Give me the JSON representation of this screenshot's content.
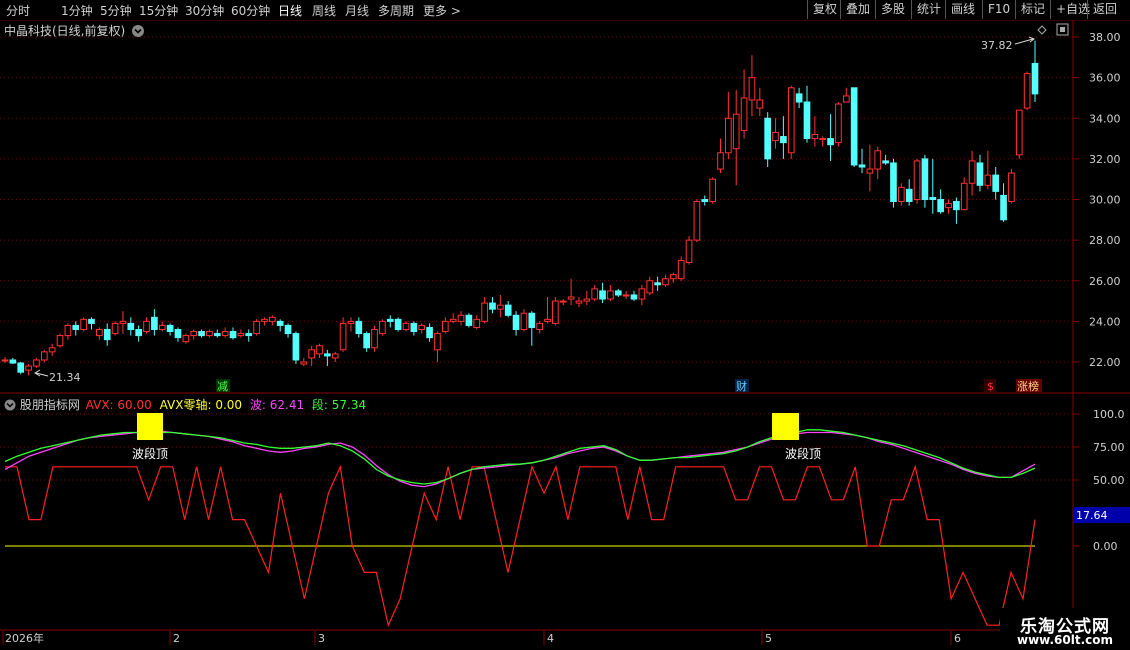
{
  "toolbar": {
    "timeframes": [
      "分时",
      "1分钟",
      "5分钟",
      "15分钟",
      "30分钟",
      "60分钟",
      "日线",
      "周线",
      "月线",
      "多周期",
      "更多"
    ],
    "active": "日线",
    "more_arrow": ">",
    "right_buttons": [
      "复权",
      "叠加",
      "多股",
      "统计",
      "画线",
      "F10",
      "标记",
      "+自选",
      "返回"
    ]
  },
  "stock": {
    "title": "中晶科技(日线,前复权)",
    "high_label": "37.82",
    "low_label": "21.34"
  },
  "price_axis": [
    "38.00",
    "36.00",
    "34.00",
    "32.00",
    "30.00",
    "28.00",
    "26.00",
    "24.00",
    "22.00"
  ],
  "markers": {
    "jian": "减",
    "cai": "财",
    "dollar": "$",
    "zhangting": "涨榜"
  },
  "indicator": {
    "name": "股朋指标网",
    "avx_label": "AVX: 60.00",
    "axis_label": "AVX零轴: 0.00",
    "bo_label": "波: 62.41",
    "duan_label": "段: 57.34",
    "current_value": "17.64",
    "axis": [
      "100.0",
      "75.00",
      "50.00",
      "0.00"
    ],
    "annotations": [
      "波段顶",
      "波段顶"
    ]
  },
  "date_axis": [
    "2026年",
    "2",
    "3",
    "4",
    "5",
    "6"
  ],
  "watermark": {
    "line1": "乐淘公式网",
    "line2": "www.60lt.com"
  },
  "colors": {
    "up": "#ff3232",
    "down": "#54ffff",
    "bo": "#ff44ff",
    "duan": "#33ff33",
    "avx": "#ff2222",
    "zero": "#ffff00",
    "marker": "#ffff00"
  },
  "chart_data": {
    "type": "candlestick",
    "price_ylim": [
      21,
      38.5
    ],
    "indicator_ylim": [
      -12,
      108
    ],
    "candles": [
      [
        22.05,
        22.1,
        21.95,
        22.25
      ],
      [
        22.1,
        21.95,
        21.9,
        22.2
      ],
      [
        21.95,
        21.5,
        21.4,
        22.0
      ],
      [
        21.6,
        21.8,
        21.34,
        21.9
      ],
      [
        21.8,
        22.1,
        21.7,
        22.2
      ],
      [
        22.1,
        22.5,
        22.0,
        22.6
      ],
      [
        22.5,
        22.7,
        22.3,
        22.9
      ],
      [
        22.8,
        23.3,
        22.7,
        23.4
      ],
      [
        23.3,
        23.8,
        23.1,
        23.9
      ],
      [
        23.8,
        23.6,
        23.3,
        24.0
      ],
      [
        23.6,
        24.1,
        23.5,
        24.2
      ],
      [
        24.1,
        23.9,
        23.6,
        24.2
      ],
      [
        23.3,
        23.6,
        23.1,
        23.7
      ],
      [
        23.6,
        23.1,
        22.8,
        23.9
      ],
      [
        23.4,
        23.9,
        23.3,
        24.0
      ],
      [
        23.9,
        24.0,
        23.4,
        24.5
      ],
      [
        23.9,
        23.6,
        23.3,
        24.2
      ],
      [
        23.6,
        23.3,
        23.0,
        23.8
      ],
      [
        23.5,
        24.0,
        23.4,
        24.2
      ],
      [
        24.2,
        23.6,
        23.3,
        24.6
      ],
      [
        23.6,
        23.8,
        23.5,
        24.0
      ],
      [
        23.8,
        23.5,
        23.3,
        23.9
      ],
      [
        23.6,
        23.2,
        23.0,
        23.7
      ],
      [
        23.0,
        23.3,
        22.9,
        23.4
      ],
      [
        23.3,
        23.5,
        23.1,
        23.6
      ],
      [
        23.5,
        23.3,
        23.2,
        23.6
      ],
      [
        23.3,
        23.5,
        23.2,
        23.6
      ],
      [
        23.4,
        23.3,
        23.2,
        23.6
      ],
      [
        23.3,
        23.5,
        23.2,
        23.7
      ],
      [
        23.5,
        23.2,
        23.1,
        23.7
      ],
      [
        23.3,
        23.4,
        23.2,
        23.6
      ],
      [
        23.4,
        23.3,
        23.0,
        23.6
      ],
      [
        23.4,
        24.0,
        23.3,
        24.1
      ],
      [
        24.0,
        24.1,
        23.8,
        24.2
      ],
      [
        24.0,
        24.2,
        23.8,
        24.3
      ],
      [
        24.0,
        23.8,
        23.5,
        24.1
      ],
      [
        23.8,
        23.4,
        23.2,
        23.9
      ],
      [
        23.4,
        22.1,
        21.9,
        23.5
      ],
      [
        21.9,
        22.0,
        21.8,
        22.2
      ],
      [
        22.2,
        22.6,
        21.8,
        22.8
      ],
      [
        22.4,
        22.8,
        22.2,
        22.9
      ],
      [
        22.4,
        22.3,
        21.8,
        22.6
      ],
      [
        22.2,
        22.4,
        22.0,
        22.5
      ],
      [
        22.6,
        23.9,
        22.5,
        24.2
      ],
      [
        23.9,
        24.0,
        23.5,
        24.2
      ],
      [
        24.0,
        23.4,
        23.2,
        24.2
      ],
      [
        23.4,
        22.7,
        22.5,
        23.5
      ],
      [
        22.7,
        23.6,
        22.5,
        23.8
      ],
      [
        23.4,
        24.0,
        23.3,
        24.1
      ],
      [
        24.1,
        24.0,
        23.7,
        24.3
      ],
      [
        24.1,
        23.6,
        23.5,
        24.2
      ],
      [
        23.6,
        23.9,
        23.5,
        24.0
      ],
      [
        23.9,
        23.5,
        23.3,
        24.0
      ],
      [
        23.6,
        23.8,
        23.4,
        23.9
      ],
      [
        23.7,
        23.2,
        23.0,
        23.9
      ],
      [
        22.6,
        23.4,
        22.0,
        23.5
      ],
      [
        23.5,
        24.0,
        23.4,
        24.2
      ],
      [
        24.0,
        24.1,
        23.9,
        24.4
      ],
      [
        24.0,
        24.3,
        23.8,
        24.5
      ],
      [
        24.3,
        23.8,
        23.7,
        24.4
      ],
      [
        23.7,
        24.1,
        23.6,
        24.3
      ],
      [
        24.0,
        24.9,
        23.9,
        25.2
      ],
      [
        24.9,
        24.6,
        24.4,
        25.2
      ],
      [
        24.6,
        24.8,
        24.2,
        25.3
      ],
      [
        24.8,
        24.3,
        24.2,
        25.0
      ],
      [
        24.3,
        23.6,
        23.3,
        24.5
      ],
      [
        23.6,
        24.4,
        23.5,
        24.6
      ],
      [
        24.4,
        23.7,
        22.8,
        24.5
      ],
      [
        23.6,
        23.9,
        23.4,
        24.0
      ],
      [
        24.0,
        24.1,
        23.9,
        25.2
      ],
      [
        23.9,
        25.0,
        23.8,
        25.2
      ],
      [
        25.0,
        25.0,
        24.8,
        25.1
      ],
      [
        25.1,
        25.2,
        24.8,
        26.1
      ],
      [
        24.9,
        25.0,
        24.7,
        25.2
      ],
      [
        25.0,
        25.1,
        24.8,
        25.5
      ],
      [
        25.1,
        25.6,
        25.0,
        25.8
      ],
      [
        25.5,
        25.1,
        24.9,
        25.9
      ],
      [
        25.1,
        25.5,
        25.0,
        25.8
      ],
      [
        25.5,
        25.3,
        25.2,
        25.6
      ],
      [
        25.3,
        25.3,
        25.1,
        25.5
      ],
      [
        25.3,
        25.1,
        25.0,
        25.5
      ],
      [
        25.1,
        25.6,
        24.8,
        25.8
      ],
      [
        25.4,
        26.0,
        25.3,
        26.2
      ],
      [
        25.9,
        25.8,
        25.5,
        26.2
      ],
      [
        25.8,
        26.1,
        25.7,
        26.3
      ],
      [
        26.1,
        26.3,
        25.9,
        26.4
      ],
      [
        26.1,
        27.0,
        26.0,
        27.2
      ],
      [
        26.9,
        28.0,
        26.8,
        28.2
      ],
      [
        28.0,
        29.9,
        27.9,
        30.0
      ],
      [
        30.0,
        29.9,
        29.7,
        30.2
      ],
      [
        29.9,
        31.0,
        29.8,
        31.1
      ],
      [
        31.5,
        32.3,
        31.3,
        33.0
      ],
      [
        32.3,
        34.0,
        32.0,
        35.3
      ],
      [
        32.5,
        34.2,
        30.7,
        35.4
      ],
      [
        33.4,
        35.0,
        33.0,
        36.4
      ],
      [
        34.9,
        36.0,
        34.1,
        37.1
      ],
      [
        34.5,
        34.9,
        34.1,
        35.5
      ],
      [
        34.0,
        32.0,
        31.6,
        34.3
      ],
      [
        32.9,
        33.3,
        32.5,
        34.0
      ],
      [
        33.1,
        32.8,
        32.0,
        34.1
      ],
      [
        32.3,
        35.5,
        32.0,
        35.6
      ],
      [
        35.2,
        34.8,
        34.5,
        35.5
      ],
      [
        34.8,
        33.0,
        32.8,
        35.6
      ],
      [
        33.0,
        33.2,
        32.6,
        34.1
      ],
      [
        33.0,
        33.0,
        32.6,
        33.1
      ],
      [
        33.0,
        32.7,
        31.9,
        34.2
      ],
      [
        32.8,
        34.7,
        32.6,
        34.8
      ],
      [
        34.8,
        35.1,
        34.8,
        35.5
      ],
      [
        35.5,
        31.7,
        31.6,
        35.4
      ],
      [
        31.7,
        31.6,
        31.3,
        32.5
      ],
      [
        31.3,
        31.5,
        30.4,
        32.7
      ],
      [
        31.5,
        32.4,
        31.0,
        32.6
      ],
      [
        31.9,
        31.8,
        31.7,
        32.2
      ],
      [
        31.8,
        29.9,
        29.6,
        32.0
      ],
      [
        29.9,
        30.6,
        29.7,
        30.8
      ],
      [
        30.5,
        29.9,
        29.7,
        31.0
      ],
      [
        30.0,
        31.9,
        29.8,
        32.0
      ],
      [
        32.0,
        30.0,
        29.6,
        32.2
      ],
      [
        30.1,
        30.0,
        29.3,
        32.0
      ],
      [
        30.0,
        29.4,
        29.3,
        30.5
      ],
      [
        29.6,
        29.8,
        29.3,
        30.0
      ],
      [
        29.9,
        29.5,
        28.8,
        30.1
      ],
      [
        29.5,
        30.8,
        29.5,
        31.1
      ],
      [
        30.8,
        31.9,
        30.2,
        32.4
      ],
      [
        31.8,
        30.7,
        30.4,
        32.2
      ],
      [
        30.7,
        31.2,
        30.5,
        32.4
      ],
      [
        31.2,
        30.4,
        30.0,
        31.6
      ],
      [
        30.2,
        29.0,
        28.9,
        30.8
      ],
      [
        29.9,
        31.3,
        29.8,
        31.5
      ],
      [
        32.2,
        34.4,
        32.0,
        34.4
      ],
      [
        34.5,
        36.2,
        34.4,
        36.3
      ],
      [
        36.7,
        35.2,
        34.8,
        37.82
      ]
    ],
    "duan": [
      64,
      68,
      71,
      74,
      76,
      78,
      80,
      82,
      84,
      85,
      86,
      86,
      86,
      86,
      86,
      85,
      84,
      83,
      82,
      80,
      78,
      77,
      75,
      74,
      74,
      75,
      76,
      78,
      76,
      72,
      66,
      58,
      53,
      50,
      48,
      47,
      48,
      51,
      55,
      58,
      60,
      61,
      62,
      62,
      63,
      65,
      68,
      71,
      74,
      75,
      76,
      73,
      68,
      65,
      65,
      66,
      67,
      67,
      68,
      69,
      70,
      72,
      75,
      79,
      82,
      84,
      86,
      88,
      88,
      87,
      86,
      84,
      82,
      80,
      78,
      76,
      73,
      70,
      67,
      63,
      59,
      56,
      54,
      52,
      52,
      55,
      59
    ],
    "bo": [
      58,
      63,
      68,
      71,
      74,
      77,
      80,
      82,
      83,
      84,
      85,
      86,
      87,
      87,
      86,
      85,
      84,
      83,
      81,
      79,
      76,
      74,
      72,
      71,
      72,
      74,
      75,
      77,
      78,
      75,
      69,
      61,
      54,
      49,
      46,
      45,
      47,
      51,
      55,
      58,
      59,
      60,
      61,
      62,
      63,
      65,
      67,
      70,
      72,
      74,
      75,
      72,
      68,
      65,
      65,
      66,
      67,
      68,
      69,
      70,
      71,
      73,
      75,
      78,
      81,
      83,
      85,
      86,
      86,
      86,
      85,
      84,
      82,
      79,
      77,
      74,
      71,
      68,
      65,
      62,
      58,
      55,
      53,
      52,
      52,
      57,
      62
    ],
    "avx": [
      60,
      60,
      20,
      20,
      60,
      60,
      60,
      60,
      60,
      60,
      60,
      60,
      35,
      60,
      60,
      20,
      60,
      20,
      60,
      20,
      20,
      0,
      -20,
      40,
      0,
      -40,
      0,
      40,
      60,
      0,
      -20,
      -20,
      -60,
      -40,
      0,
      40,
      20,
      60,
      20,
      60,
      60,
      20,
      -20,
      20,
      60,
      40,
      60,
      20,
      60,
      60,
      60,
      60,
      20,
      60,
      20,
      20,
      60,
      60,
      60,
      60,
      60,
      35,
      35,
      60,
      60,
      35,
      35,
      60,
      60,
      35,
      35,
      60,
      0,
      0,
      35,
      35,
      60,
      20,
      20,
      -40,
      -20,
      -40,
      -60,
      -60,
      -20,
      -40,
      20
    ],
    "avx_current": 17.64
  }
}
